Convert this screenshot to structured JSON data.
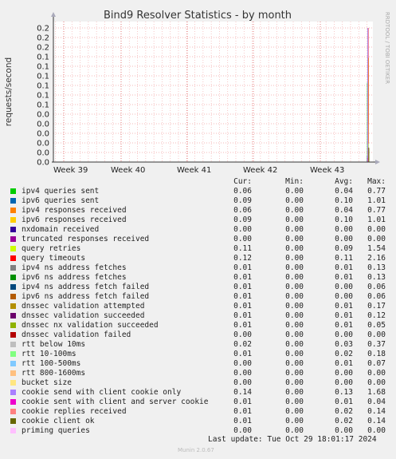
{
  "chart_data": {
    "type": "line",
    "title": "Bind9 Resolver Statistics - by month",
    "ylabel": "requests/second",
    "side_label": "RRDTOOL / TOBI OETIKER",
    "yticks": [
      "0.0",
      "0.0",
      "0.0",
      "0.0",
      "0.0",
      "0.0",
      "0.1",
      "0.1",
      "0.1",
      "0.1",
      "0.1",
      "0.1",
      "0.2",
      "0.2",
      "0.2"
    ],
    "ylim": [
      0,
      1.3
    ],
    "xticks": [
      "Week 39",
      "Week 40",
      "Week 41",
      "Week 42",
      "Week 43"
    ],
    "columns": {
      "cur": "Cur:",
      "min": "Min:",
      "avg": "Avg:",
      "max": "Max:"
    },
    "series": [
      {
        "name": "ipv4 queries sent",
        "color": "#00cc00",
        "cur": "0.06",
        "min": "0.00",
        "avg": "0.04",
        "max": "0.77"
      },
      {
        "name": "ipv6 queries sent",
        "color": "#0066b3",
        "cur": "0.09",
        "min": "0.00",
        "avg": "0.10",
        "max": "1.01"
      },
      {
        "name": "ipv4 responses received",
        "color": "#ff8000",
        "cur": "0.06",
        "min": "0.00",
        "avg": "0.04",
        "max": "0.77"
      },
      {
        "name": "ipv6 responses received",
        "color": "#ffcc00",
        "cur": "0.09",
        "min": "0.00",
        "avg": "0.10",
        "max": "1.01"
      },
      {
        "name": "nxdomain received",
        "color": "#330099",
        "cur": "0.00",
        "min": "0.00",
        "avg": "0.00",
        "max": "0.00"
      },
      {
        "name": "truncated responses received",
        "color": "#990099",
        "cur": "0.00",
        "min": "0.00",
        "avg": "0.00",
        "max": "0.00"
      },
      {
        "name": "query retries",
        "color": "#ccff00",
        "cur": "0.11",
        "min": "0.00",
        "avg": "0.09",
        "max": "1.54"
      },
      {
        "name": "query timeouts",
        "color": "#ff0000",
        "cur": "0.12",
        "min": "0.00",
        "avg": "0.11",
        "max": "2.16"
      },
      {
        "name": "ipv4 ns address fetches",
        "color": "#808080",
        "cur": "0.01",
        "min": "0.00",
        "avg": "0.01",
        "max": "0.13"
      },
      {
        "name": "ipv6 ns address fetches",
        "color": "#008f00",
        "cur": "0.01",
        "min": "0.00",
        "avg": "0.01",
        "max": "0.13"
      },
      {
        "name": "ipv4 ns address fetch failed",
        "color": "#00487d",
        "cur": "0.01",
        "min": "0.00",
        "avg": "0.00",
        "max": "0.06"
      },
      {
        "name": "ipv6 ns address fetch failed",
        "color": "#b35a00",
        "cur": "0.01",
        "min": "0.00",
        "avg": "0.00",
        "max": "0.06"
      },
      {
        "name": "dnssec validation attempted",
        "color": "#b38f00",
        "cur": "0.01",
        "min": "0.00",
        "avg": "0.01",
        "max": "0.17"
      },
      {
        "name": "dnssec validation succeeded",
        "color": "#6b006b",
        "cur": "0.01",
        "min": "0.00",
        "avg": "0.01",
        "max": "0.12"
      },
      {
        "name": "dnssec nx validation succeeded",
        "color": "#8fb300",
        "cur": "0.01",
        "min": "0.00",
        "avg": "0.01",
        "max": "0.05"
      },
      {
        "name": "dnssec validation failed",
        "color": "#b30000",
        "cur": "0.00",
        "min": "0.00",
        "avg": "0.00",
        "max": "0.00"
      },
      {
        "name": "rtt below 10ms",
        "color": "#bebebe",
        "cur": "0.02",
        "min": "0.00",
        "avg": "0.03",
        "max": "0.37"
      },
      {
        "name": "rtt 10-100ms",
        "color": "#80ff80",
        "cur": "0.01",
        "min": "0.00",
        "avg": "0.02",
        "max": "0.18"
      },
      {
        "name": "rtt 100-500ms",
        "color": "#80c9ff",
        "cur": "0.00",
        "min": "0.00",
        "avg": "0.01",
        "max": "0.07"
      },
      {
        "name": "rtt 800-1600ms",
        "color": "#ffc080",
        "cur": "0.00",
        "min": "0.00",
        "avg": "0.00",
        "max": "0.00"
      },
      {
        "name": "bucket size",
        "color": "#ffe680",
        "cur": "0.00",
        "min": "0.00",
        "avg": "0.00",
        "max": "0.00"
      },
      {
        "name": "cookie send with client cookie only",
        "color": "#aa80ff",
        "cur": "0.14",
        "min": "0.00",
        "avg": "0.13",
        "max": "1.68"
      },
      {
        "name": "cookie sent with client and server cookie",
        "color": "#ee00cc",
        "cur": "0.01",
        "min": "0.00",
        "avg": "0.01",
        "max": "0.04"
      },
      {
        "name": "cookie replies received",
        "color": "#ff8080",
        "cur": "0.01",
        "min": "0.00",
        "avg": "0.02",
        "max": "0.14"
      },
      {
        "name": "cookie client ok",
        "color": "#666600",
        "cur": "0.01",
        "min": "0.00",
        "avg": "0.02",
        "max": "0.14"
      },
      {
        "name": "priming queries",
        "color": "#ffbfff",
        "cur": "0.00",
        "min": "0.00",
        "avg": "0.00",
        "max": "0.00"
      }
    ]
  },
  "footer": {
    "last_update": "Last update: Tue Oct 29 18:01:17 2024",
    "munin": "Munin 2.0.67"
  }
}
